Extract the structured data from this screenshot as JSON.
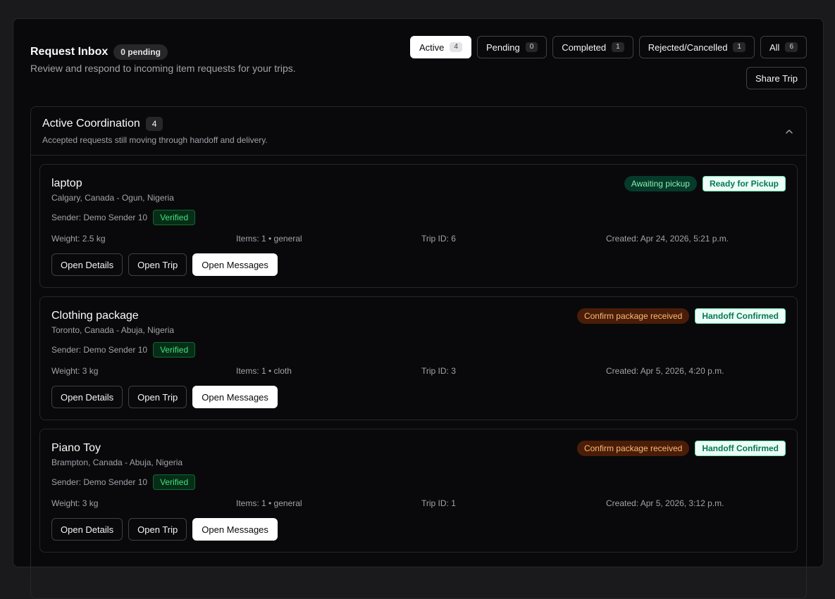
{
  "header": {
    "title": "Request Inbox",
    "pending_badge": "0 pending",
    "subtitle": "Review and respond to incoming item requests for your trips."
  },
  "filters": [
    {
      "label": "Active",
      "count": "4",
      "active": true
    },
    {
      "label": "Pending",
      "count": "0"
    },
    {
      "label": "Completed",
      "count": "1"
    },
    {
      "label": "Rejected/Cancelled",
      "count": "1"
    },
    {
      "label": "All",
      "count": "6"
    }
  ],
  "share_label": "Share Trip",
  "section": {
    "title": "Active Coordination",
    "count": "4",
    "description": "Accepted requests still moving through handoff and delivery.",
    "icon": "chevron-up-icon"
  },
  "colors": {
    "accent": "#ffffff",
    "verified": "#4ade80",
    "awaiting": "#86efac",
    "confirm": "#fdba74",
    "stage": "#047857"
  },
  "requests": [
    {
      "title": "laptop",
      "route": "Calgary, Canada - Ogun, Nigeria",
      "sender": "Sender: Demo Sender 10",
      "verified": "Verified",
      "weight": "Weight: 2.5 kg",
      "items": "Items: 1 • general",
      "trip": "Trip ID: 6",
      "created": "Created: Apr 24, 2026, 5:21 p.m.",
      "status": "Awaiting pickup",
      "stage": "Ready for Pickup",
      "actions": [
        "Open Details",
        "Open Trip",
        "Open Messages"
      ]
    },
    {
      "title": "Clothing package",
      "route": "Toronto, Canada - Abuja, Nigeria",
      "sender": "Sender: Demo Sender 10",
      "verified": "Verified",
      "weight": "Weight: 3 kg",
      "items": "Items: 1 • cloth",
      "trip": "Trip ID: 3",
      "created": "Created: Apr 5, 2026, 4:20 p.m.",
      "status": "Confirm package received",
      "stage": "Handoff Confirmed",
      "actions": [
        "Open Details",
        "Open Trip",
        "Open Messages"
      ]
    },
    {
      "title": "Piano Toy",
      "route": "Brampton, Canada - Abuja, Nigeria",
      "sender": "Sender: Demo Sender 10",
      "verified": "Verified",
      "weight": "Weight: 3 kg",
      "items": "Items: 1 • general",
      "trip": "Trip ID: 1",
      "created": "Created: Apr 5, 2026, 3:12 p.m.",
      "status": "Confirm package received",
      "stage": "Handoff Confirmed",
      "actions": [
        "Open Details",
        "Open Trip",
        "Open Messages"
      ]
    }
  ]
}
